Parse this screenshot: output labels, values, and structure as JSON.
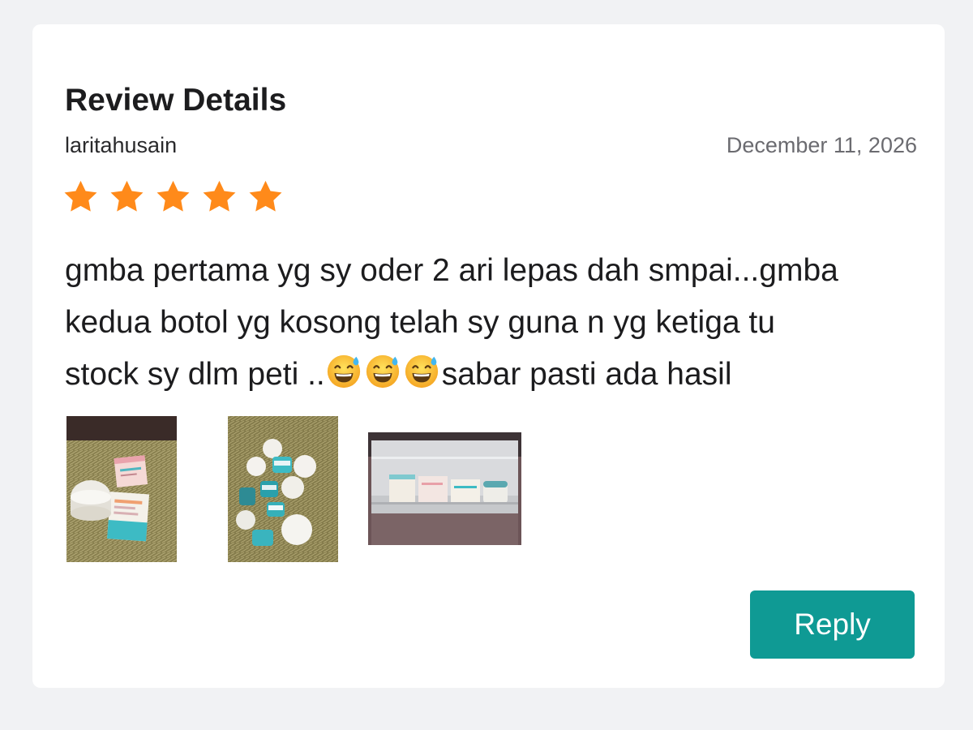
{
  "review": {
    "title": "Review Details",
    "reviewer": "laritahusain",
    "date": "December 11, 2026",
    "rating": 5,
    "rating_max": 5,
    "text_segments": {
      "line1": "gmba pertama yg sy oder 2 ari lepas dah smpai...gmba",
      "line2": "kedua botol yg kosong telah sy guna n yg ketiga tu",
      "line3_start": "stock sy dlm peti ..",
      "line3_end": "sabar pasti ada hasil"
    },
    "emojis": [
      "grinning-face-with-sweat-icon",
      "grinning-face-with-sweat-icon",
      "grinning-face-with-sweat-icon"
    ],
    "photos": [
      {
        "name": "review-photo-1",
        "depicts": "boxes-and-jar-on-carpet"
      },
      {
        "name": "review-photo-2",
        "depicts": "jars-on-carpet"
      },
      {
        "name": "review-photo-3",
        "depicts": "boxes-in-fridge"
      }
    ]
  },
  "actions": {
    "reply_label": "Reply"
  },
  "colors": {
    "star": "#ff8a1a",
    "reply_button": "#0f9a94",
    "background": "#f1f2f4",
    "card": "#ffffff"
  }
}
